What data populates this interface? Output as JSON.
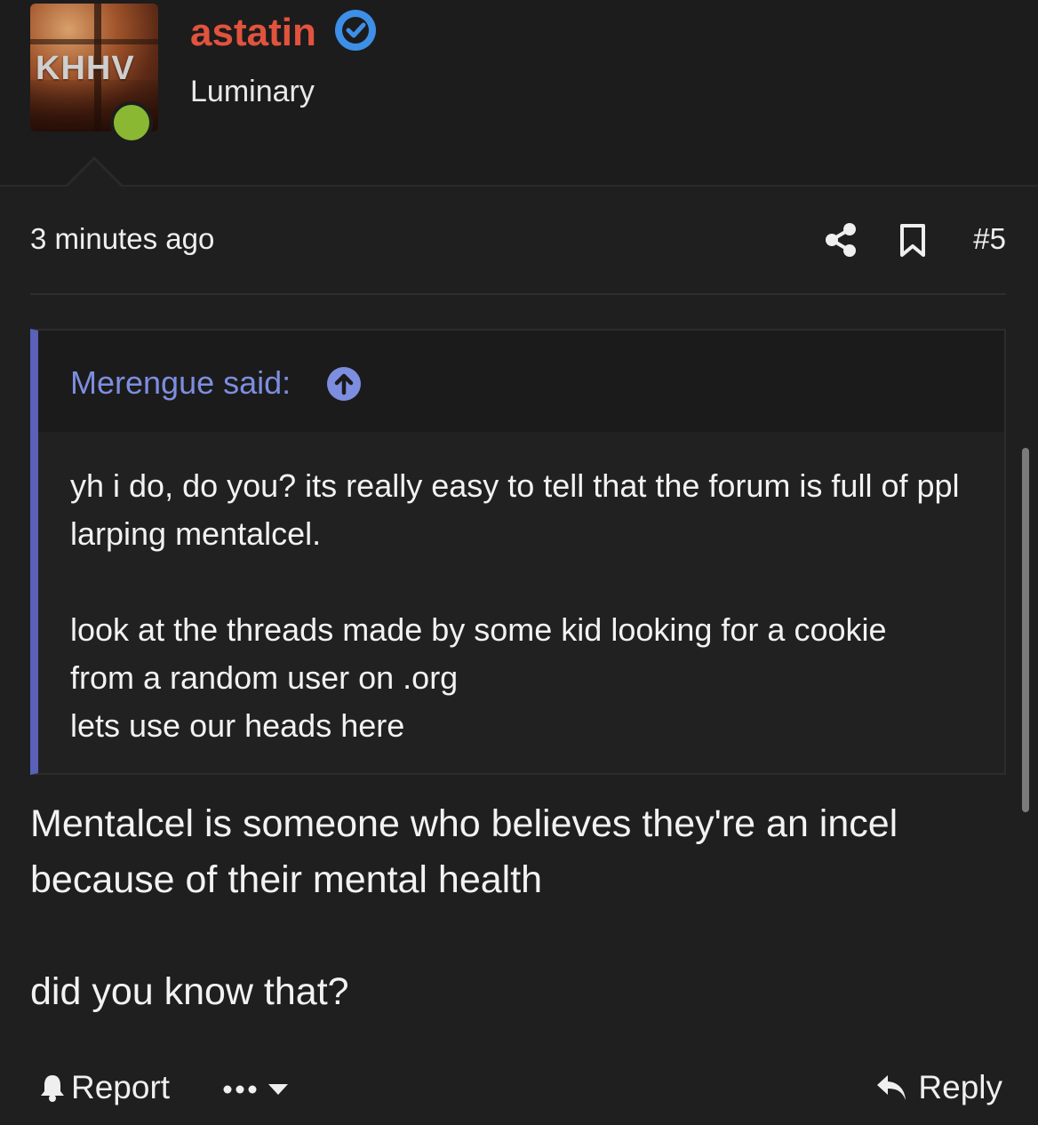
{
  "author": {
    "avatar_text": "KHHV",
    "username": "astatin",
    "title": "Luminary",
    "verified_icon": "verified-check-icon",
    "online": true
  },
  "post": {
    "timestamp": "3 minutes ago",
    "number": "#5",
    "share_icon": "share-icon",
    "bookmark_icon": "bookmark-icon"
  },
  "quote": {
    "author_label": "Merengue said:",
    "jump_icon": "arrow-up-circle-icon",
    "paragraphs": [
      "yh i do, do you? its really easy to tell that the forum is full of ppl larping mentalcel.",
      "look at the threads made by some kid looking for a cookie",
      "from a random user on .org",
      "lets use our heads here"
    ]
  },
  "message": {
    "line1": "Mentalcel is someone who believes they're an incel because of their mental health",
    "line2": "did you know that?"
  },
  "actions": {
    "report_label": "Report",
    "reply_label": "Reply",
    "more_icon": "ellipsis-icon"
  },
  "colors": {
    "username": "#e2533e",
    "online": "#8ab833",
    "verified": "#3d8fe8",
    "quote_accent": "#5b60b8",
    "quote_author": "#7d8ee0"
  }
}
